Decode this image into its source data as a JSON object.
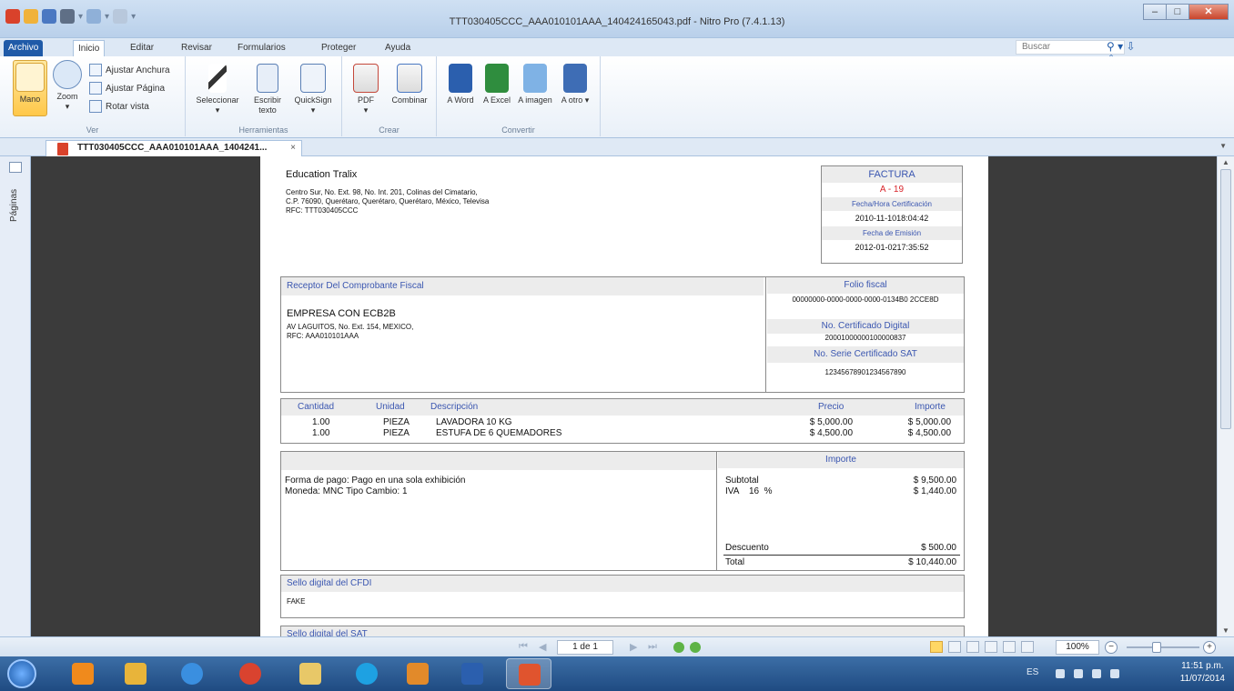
{
  "window": {
    "title": "TTT030405CCC_AAA010101AAA_140424165043.pdf - Nitro Pro (7.4.1.13)",
    "min": "–",
    "max": "□",
    "close": "✕"
  },
  "menu_tabs": [
    "Archivo",
    "Inicio",
    "Editar",
    "Revisar",
    "Formularios",
    "Proteger",
    "Ayuda"
  ],
  "search": {
    "placeholder": "Buscar"
  },
  "ribbon": {
    "ver": {
      "label": "Ver",
      "mano": "Mano",
      "zoom": "Zoom",
      "ajustar_anchura": "Ajustar Anchura",
      "ajustar_pagina": "Ajustar Página",
      "rotar_vista": "Rotar vista"
    },
    "herramientas": {
      "label": "Herramientas",
      "seleccionar": "Seleccionar",
      "escribir": "Escribir texto",
      "quicksign": "QuickSign"
    },
    "crear": {
      "label": "Crear",
      "pdf": "PDF",
      "combinar": "Combinar"
    },
    "convertir": {
      "label": "Convertir",
      "word": "A Word",
      "excel": "A Excel",
      "imagen": "A imagen",
      "otro": "A otro"
    }
  },
  "doc_tab": {
    "title": "TTT030405CCC_AAA010101AAA_1404241...",
    "close": "×"
  },
  "side_panel": {
    "label": "Páginas"
  },
  "invoice": {
    "emisor": {
      "name": "Education Tralix",
      "address1": "Centro Sur, No. Ext. 98, No. Int. 201, Colinas del Cimatario,",
      "address2": "C.P. 76090, Querétaro, Querétaro, Querétaro, México, Televisa",
      "rfc": "RFC: TTT030405CCC"
    },
    "factura": {
      "title": "FACTURA",
      "number": "A - 19",
      "cert_label": "Fecha/Hora Certificación",
      "cert_value": "2010-11-1018:04:42",
      "emision_label": "Fecha de Emisión",
      "emision_value": "2012-01-0217:35:52"
    },
    "receptor": {
      "header": "Receptor Del Comprobante Fiscal",
      "name": "EMPRESA CON ECB2B",
      "address": "AV LAGUITOS, No. Ext. 154, MEXICO,",
      "rfc": "RFC: AAA010101AAA"
    },
    "fiscal": {
      "folio_label": "Folio fiscal",
      "folio_value": "00000000-0000-0000-0000-0134B0 2CCE8D",
      "cert_label": "No. Certificado Digital",
      "cert_value": "20001000000100000837",
      "sat_label": "No. Serie Certificado SAT",
      "sat_value": "12345678901234567890"
    },
    "items_header": {
      "cantidad": "Cantidad",
      "unidad": "Unidad",
      "descripcion": "Descripción",
      "precio": "Precio",
      "importe": "Importe"
    },
    "items": [
      {
        "cantidad": "1.00",
        "unidad": "PIEZA",
        "descripcion": "LAVADORA 10 KG",
        "precio": "$ 5,000.00",
        "importe": "$ 5,000.00"
      },
      {
        "cantidad": "1.00",
        "unidad": "PIEZA",
        "descripcion": "ESTUFA DE 6 QUEMADORES",
        "precio": "$ 4,500.00",
        "importe": "$ 4,500.00"
      }
    ],
    "payment": {
      "forma": "Forma de pago: Pago en una sola exhibición",
      "moneda": "Moneda: MNC Tipo Cambio: 1"
    },
    "totals": {
      "header": "Importe",
      "subtotal_label": "Subtotal",
      "subtotal": "$ 9,500.00",
      "iva_label": "IVA    16  %",
      "iva": "$ 1,440.00",
      "descuento_label": "Descuento",
      "descuento": "$ 500.00",
      "total_label": "Total",
      "total": "$ 10,440.00"
    },
    "sello_cfdi": {
      "header": "Sello digital del CFDI",
      "value": "FAKE"
    },
    "sello_sat": {
      "header": "Sello digital del SAT"
    }
  },
  "status": {
    "page": "1 de 1",
    "zoom": "100%",
    "zoom_minus": "−",
    "zoom_plus": "+"
  },
  "taskbar": {
    "lang": "ES",
    "time": "11:51 p.m.",
    "date": "11/07/2014"
  },
  "colors": {
    "accent": "#1f5aa8",
    "invoice_blue": "#3a56b0",
    "invoice_red": "#d8252b",
    "doc_background": "#3b3b3b"
  }
}
